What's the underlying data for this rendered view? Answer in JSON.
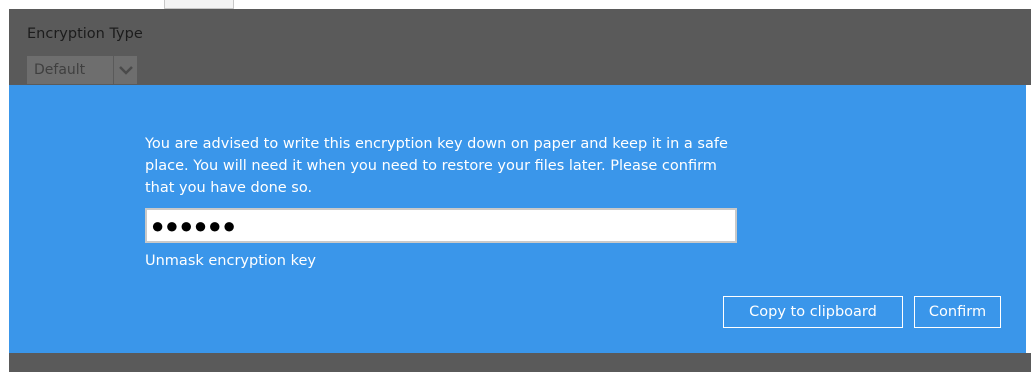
{
  "background": {
    "encryption_type_label": "Encryption Type",
    "encryption_type_value": "Default"
  },
  "dialog": {
    "message": "You are advised to write this encryption key down on paper and keep it in a safe place. You will need it when you need to restore your files later. Please confirm that you have done so.",
    "key_masked": "●●●●●●",
    "unmask_link": "Unmask encryption key",
    "copy_button": "Copy to clipboard",
    "confirm_button": "Confirm"
  },
  "colors": {
    "dialog_bg": "#3a96ea",
    "overlay_bg": "#5a5a5a"
  },
  "icons": {
    "dropdown": "chevron-down-icon"
  }
}
